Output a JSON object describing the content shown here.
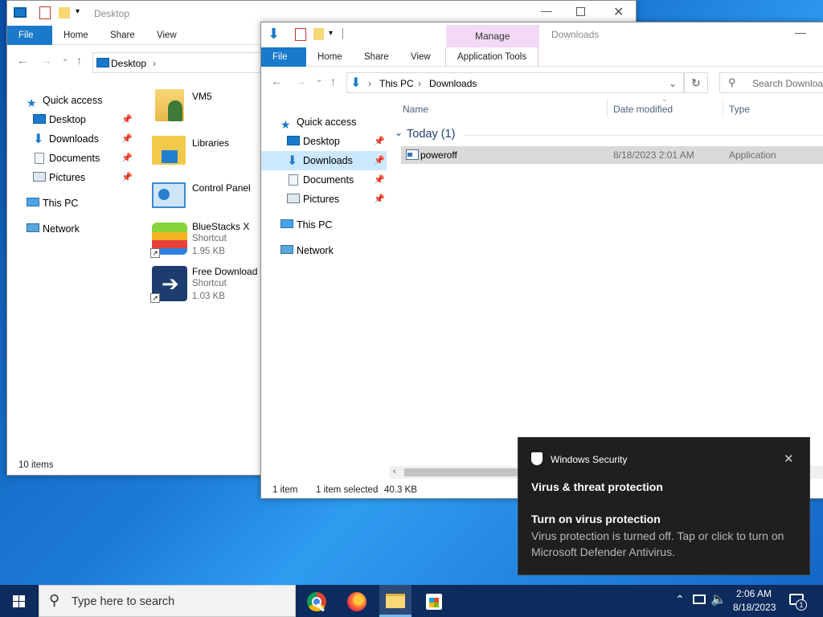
{
  "desktop_window": {
    "title": "Desktop",
    "tabs": [
      "File",
      "Home",
      "Share",
      "View"
    ],
    "address": "Desktop",
    "nav": {
      "quick_access": "Quick access",
      "items": [
        "Desktop",
        "Downloads",
        "Documents",
        "Pictures"
      ],
      "this_pc": "This PC",
      "network": "Network"
    },
    "files": [
      {
        "name": "VM5",
        "lines": []
      },
      {
        "name": "Libraries",
        "lines": []
      },
      {
        "name": "Control Panel",
        "lines": []
      },
      {
        "name": "BlueStacks X",
        "lines": [
          "Shortcut",
          "1.95 KB"
        ]
      },
      {
        "name": "Free Download Manager",
        "lines": [
          "Shortcut",
          "1.03 KB"
        ]
      }
    ],
    "status": "10 items"
  },
  "downloads_window": {
    "title": "Downloads",
    "context_tab_group": "Manage",
    "tabs": [
      "File",
      "Home",
      "Share",
      "View",
      "Application Tools"
    ],
    "breadcrumb": [
      "This PC",
      "Downloads"
    ],
    "search_placeholder": "Search Downloads",
    "nav": {
      "quick_access": "Quick access",
      "items": [
        "Desktop",
        "Downloads",
        "Documents",
        "Pictures"
      ],
      "this_pc": "This PC",
      "network": "Network"
    },
    "columns": [
      "Name",
      "Date modified",
      "Type"
    ],
    "group_label": "Today (1)",
    "rows": [
      {
        "name": "poweroff",
        "date": "8/18/2023 2:01 AM",
        "type": "Application"
      }
    ],
    "status": {
      "count": "1 item",
      "selected": "1 item selected",
      "size": "40.3 KB"
    }
  },
  "toast": {
    "app": "Windows Security",
    "heading": "Virus & threat protection",
    "title": "Turn on virus protection",
    "body": "Virus protection is turned off. Tap or click to turn on Microsoft Defender Antivirus."
  },
  "taskbar": {
    "search_placeholder": "Type here to search",
    "time": "2:06 AM",
    "date": "8/18/2023",
    "notification_count": "1"
  },
  "colors": {
    "accent": "#1979ca",
    "selection": "#cce8ff",
    "context_tab": "#f3d9f5",
    "toast_bg": "#1f1f1f",
    "taskbar_bg": "#0d2b5c"
  }
}
